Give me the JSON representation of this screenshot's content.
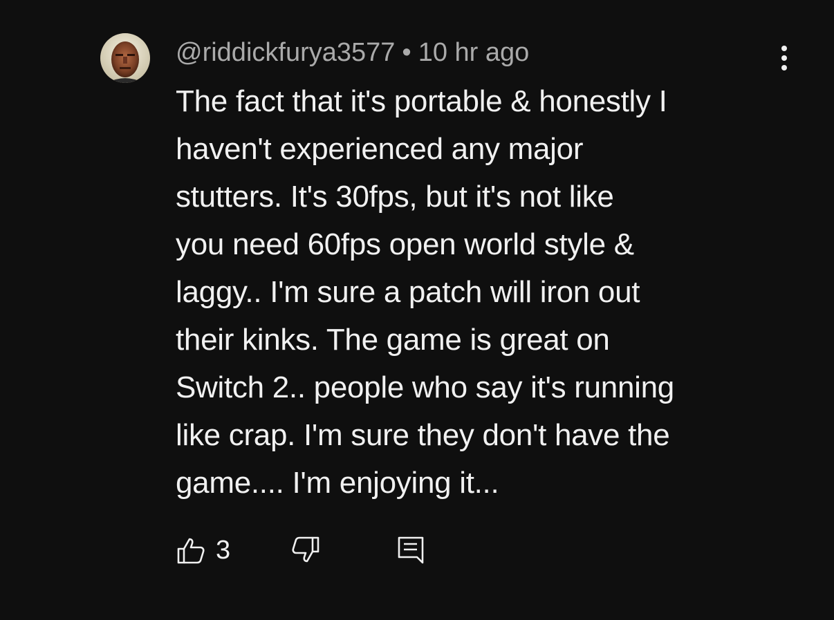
{
  "comment": {
    "author": "@riddickfurya3577",
    "separator": "•",
    "timestamp": "10 hr ago",
    "text": "The fact that it's portable & honestly I\nhaven't experienced any major\nstutters. It's 30fps, but it's not like\nyou need 60fps open world style &\nlaggy.. I'm sure a patch will iron out\ntheir kinks. The game is great on\nSwitch 2.. people who say it's running\nlike crap. I'm sure they don't have the\ngame.... I'm enjoying it...",
    "like_count": "3"
  },
  "icons": {
    "avatar": "avatar-photo",
    "menu": "more-vertical-icon",
    "like": "thumbs-up-icon",
    "dislike": "thumbs-down-icon",
    "reply": "reply-comment-icon"
  },
  "colors": {
    "background": "#0f0f0f",
    "primary_text": "#f1f1f1",
    "secondary_text": "#aaaaaa"
  }
}
